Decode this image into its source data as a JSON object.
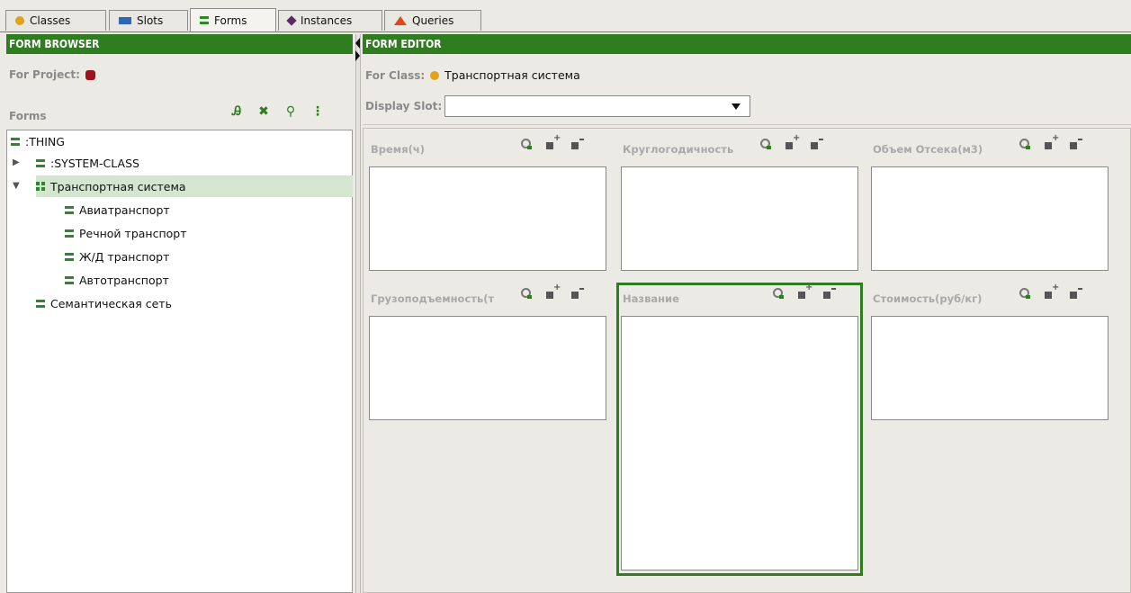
{
  "tabs": [
    {
      "label": "Classes",
      "icon": "class-circle-icon"
    },
    {
      "label": "Slots",
      "icon": "slot-bar-icon"
    },
    {
      "label": "Forms",
      "icon": "form-icon"
    },
    {
      "label": "Instances",
      "icon": "instance-diamond-icon"
    },
    {
      "label": "Queries",
      "icon": "query-triangle-icon"
    }
  ],
  "form_browser": {
    "title": "FORM BROWSER",
    "for_project_label": "For Project:",
    "forms_label": "Forms",
    "tree": [
      {
        "label": ":THING"
      },
      {
        "label": ":SYSTEM-CLASS"
      },
      {
        "label": "Транспортная система"
      },
      {
        "label": "Авиатранспорт"
      },
      {
        "label": "Речной транспорт"
      },
      {
        "label": "Ж/Д транспорт"
      },
      {
        "label": "Автотранспорт"
      },
      {
        "label": "Семантическая сеть"
      }
    ]
  },
  "form_editor": {
    "title": "FORM EDITOR",
    "for_class_label": "For Class:",
    "for_class_value": "Транспортная система",
    "display_slot_label": "Display Slot:",
    "display_slot_value": "",
    "widgets": [
      {
        "label": "Время(ч)"
      },
      {
        "label": "Круглогодичность"
      },
      {
        "label": "Объем Отсека(м3)"
      },
      {
        "label": "Грузоподъемность(т"
      },
      {
        "label": "Название"
      },
      {
        "label": "Стоимость(руб/кг)"
      }
    ]
  },
  "colors": {
    "header_green": "#2e7d1f",
    "selection_green": "#d5e6d0"
  }
}
